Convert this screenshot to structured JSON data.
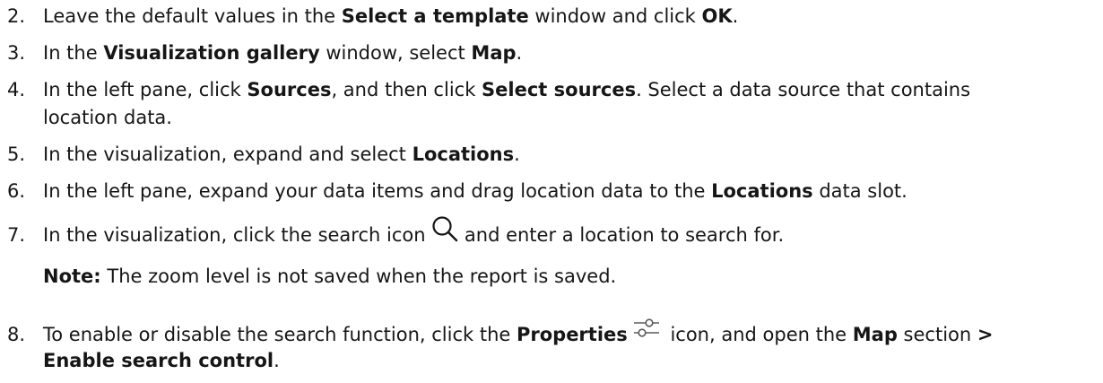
{
  "steps": [
    {
      "number": "2.",
      "t1": "Leave the default values in the ",
      "b1": "Select a template",
      "t2": " window and click ",
      "b2": "OK",
      "t3": "."
    },
    {
      "number": "3.",
      "t1": "In the ",
      "b1": "Visualization gallery",
      "t2": " window, select ",
      "b2": "Map",
      "t3": "."
    },
    {
      "number": "4.",
      "t1": "In the left pane, click ",
      "b1": "Sources",
      "t2": ", and then click ",
      "b2": "Select sources",
      "t3": ". Select a data source that contains",
      "t4": "location data."
    },
    {
      "number": "5.",
      "t1": "In the visualization, expand and select ",
      "b1": "Locations",
      "t2": "."
    },
    {
      "number": "6.",
      "t1": "In the left pane, expand your data items and drag location data to the ",
      "b1": "Locations",
      "t2": " data slot."
    },
    {
      "number": "7.",
      "t1": "In the visualization, click the search icon ",
      "icon": "search-icon",
      "t2": " and enter a location to search for.",
      "note_label": "Note:",
      "note_text": " The zoom level is not saved when the report is saved."
    },
    {
      "number": "8.",
      "t1": "To enable or disable the search function, click the ",
      "b1": "Properties",
      "icon": "properties-icon",
      "t2": " icon, and open the ",
      "b2": "Map",
      "t3": " section ",
      "b3": ">",
      "b4": "Enable search control",
      "t4": "."
    }
  ]
}
